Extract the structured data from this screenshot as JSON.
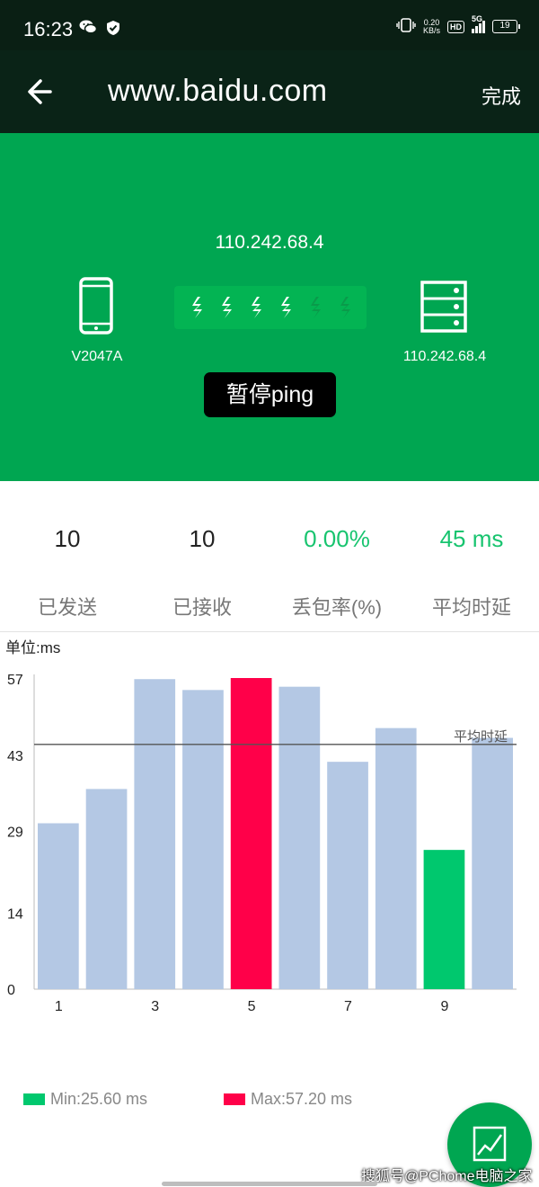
{
  "status_bar": {
    "time": "16:23",
    "net_speed_value": "0.20",
    "net_speed_unit": "KB/s",
    "hd": "HD",
    "network": "5G",
    "battery": "19"
  },
  "app_bar": {
    "title": "www.baidu.com",
    "done_label": "完成"
  },
  "hero": {
    "target_ip": "110.242.68.4",
    "device_name": "V2047A",
    "server_ip": "110.242.68.4",
    "pause_label": "暂停ping",
    "pulses_active": 4,
    "pulses_total": 6
  },
  "stats": [
    {
      "value": "10",
      "label": "已发送",
      "highlight": false
    },
    {
      "value": "10",
      "label": "已接收",
      "highlight": false
    },
    {
      "value": "0.00%",
      "label": "丢包率(%)",
      "highlight": true
    },
    {
      "value": "45 ms",
      "label": "平均时延",
      "highlight": true
    }
  ],
  "chart_unit": "单位:ms",
  "chart_data": {
    "type": "bar",
    "categories": [
      "1",
      "2",
      "3",
      "4",
      "5",
      "6",
      "7",
      "8",
      "9",
      "10"
    ],
    "x_tick_labels": [
      "1",
      "",
      "3",
      "",
      "5",
      "",
      "7",
      "",
      "9",
      ""
    ],
    "values": [
      30.5,
      36.8,
      57.0,
      55.0,
      57.2,
      55.6,
      41.8,
      48.0,
      25.6,
      46.2
    ],
    "y_ticks": [
      0,
      14,
      29,
      43,
      57
    ],
    "ylim": [
      0,
      57.2
    ],
    "avg_line_value": 45,
    "avg_line_label": "平均时延",
    "min_index": 8,
    "max_index": 4,
    "colors": {
      "bar": "#b4c8e4",
      "min": "#00c86e",
      "max": "#ff0049",
      "avg_line": "#555555"
    }
  },
  "legend": {
    "min_label": "Min:25.60 ms",
    "max_label": "Max:57.20 ms"
  },
  "watermark": "搜狐号@PChome电脑之家",
  "colors": {
    "primary": "#00a651",
    "status_bar": "#0a1f14",
    "app_bar": "#0a2317"
  }
}
